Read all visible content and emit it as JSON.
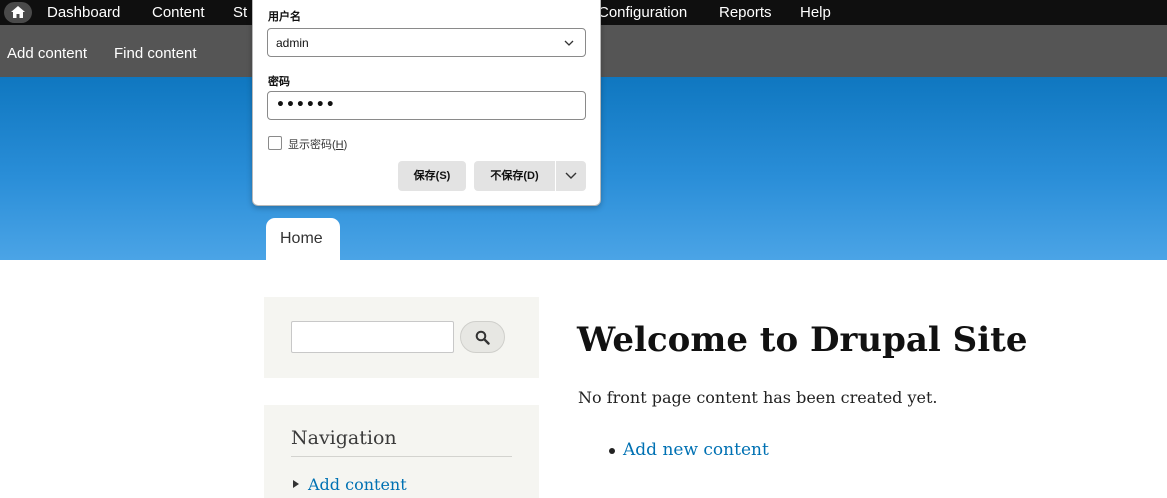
{
  "toolbar": {
    "items": [
      "Dashboard",
      "Content",
      "St",
      "Configuration",
      "Reports",
      "Help"
    ]
  },
  "tray": {
    "items": [
      "Add content",
      "Find content"
    ]
  },
  "tabs": {
    "home": "Home"
  },
  "sidebar": {
    "search": {
      "placeholder": ""
    },
    "navigation": {
      "title": "Navigation",
      "links": [
        "Add content"
      ]
    }
  },
  "main": {
    "title": "Welcome to Drupal Site",
    "text": "No front page content has been created yet.",
    "links": [
      "Add new content"
    ]
  },
  "password_popup": {
    "username_label": "用户名",
    "username_value": "admin",
    "password_label": "密码",
    "password_value": "••••••",
    "show_password_text": "显示密码(",
    "show_password_key": "H",
    "show_password_close": ")",
    "save_button": "保存(S)",
    "nosave_button": "不保存(D)"
  },
  "colors": {
    "toolbar": "#0f0f0f",
    "tray": "#555555",
    "header_top": "#0f77c0",
    "header_bottom": "#4ba4e6",
    "link": "#0071b3",
    "sidebar_bg": "#f5f5f1"
  },
  "icons": {
    "home": "home-icon",
    "search": "search-icon",
    "dropdown": "chevron-down-icon"
  }
}
